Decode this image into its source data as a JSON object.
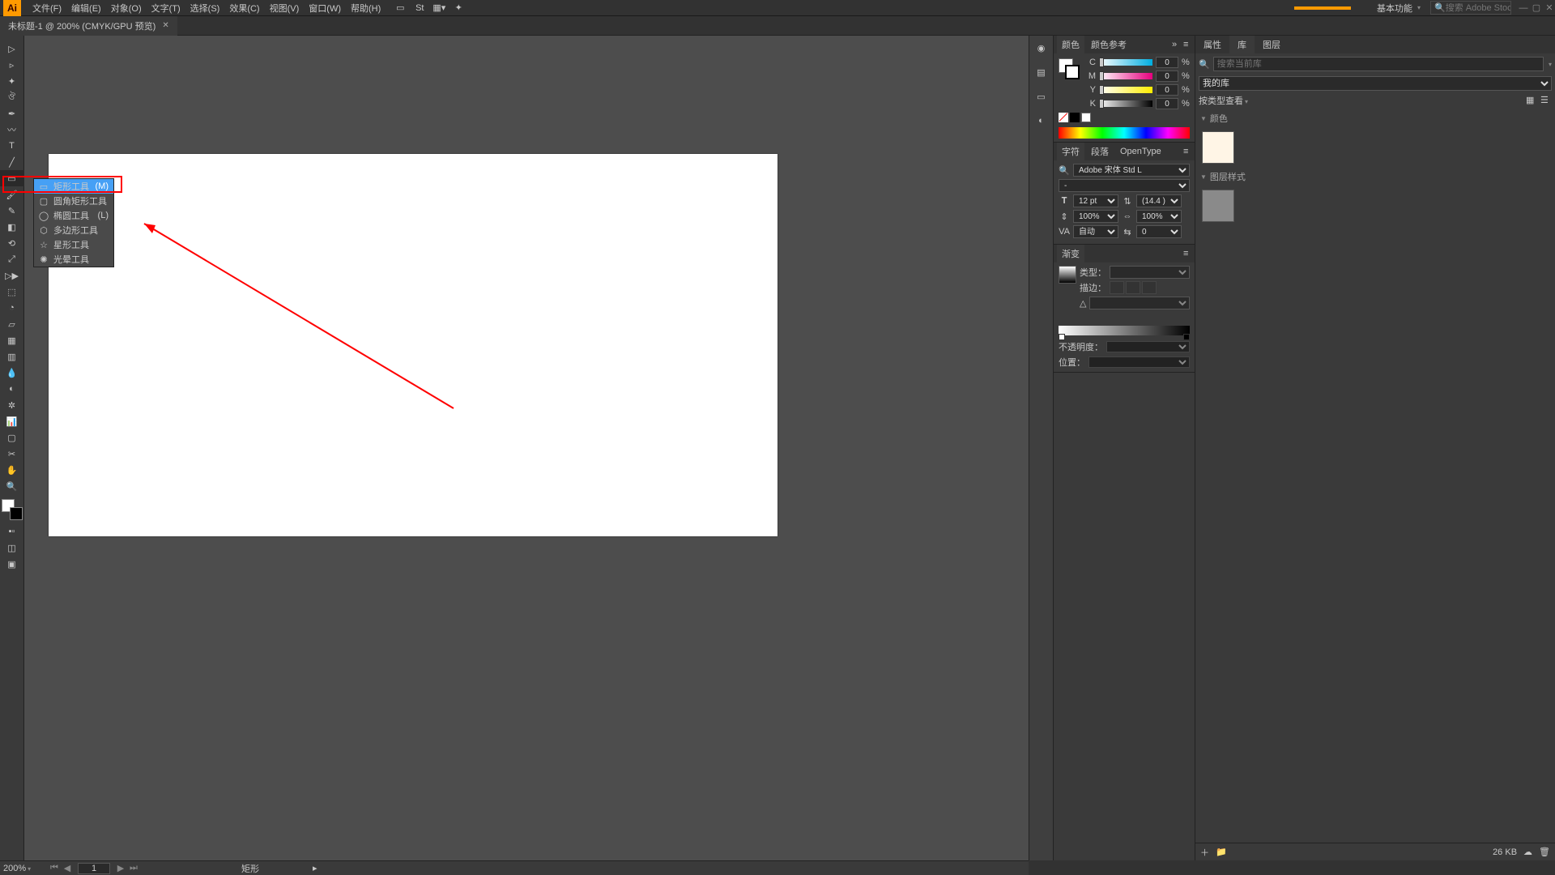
{
  "menu": {
    "items": [
      "文件(F)",
      "编辑(E)",
      "对象(O)",
      "文字(T)",
      "选择(S)",
      "效果(C)",
      "视图(V)",
      "窗口(W)",
      "帮助(H)"
    ],
    "workspace": "基本功能",
    "search_placeholder": "搜索 Adobe Stock"
  },
  "doc": {
    "title": "未标题-1 @ 200% (CMYK/GPU 预览)"
  },
  "flyout": {
    "items": [
      {
        "label": "矩形工具",
        "shortcut": "(M)",
        "active": true
      },
      {
        "label": "圆角矩形工具",
        "shortcut": ""
      },
      {
        "label": "椭圆工具",
        "shortcut": "(L)"
      },
      {
        "label": "多边形工具",
        "shortcut": ""
      },
      {
        "label": "星形工具",
        "shortcut": ""
      },
      {
        "label": "光晕工具",
        "shortcut": ""
      }
    ]
  },
  "color": {
    "tab1": "颜色",
    "tab2": "颜色参考",
    "channels": [
      {
        "l": "C",
        "v": "0"
      },
      {
        "l": "M",
        "v": "0"
      },
      {
        "l": "Y",
        "v": "0"
      },
      {
        "l": "K",
        "v": "0"
      }
    ],
    "pct": "%"
  },
  "char": {
    "tab1": "字符",
    "tab2": "段落",
    "tab3": "OpenType",
    "font": "Adobe 宋体 Std L",
    "style": "-",
    "size": "12 pt",
    "leading": "(14.4 )",
    "hscale": "100%",
    "vscale": "100%",
    "tracking": "自动",
    "baseline": "0"
  },
  "grad": {
    "tab": "渐变",
    "type_label": "类型：",
    "stroke_label": "描边：",
    "angle_label": "△",
    "opacity_label": "不透明度：",
    "location_label": "位置："
  },
  "libs": {
    "tabs": [
      "属性",
      "库",
      "图层"
    ],
    "search_placeholder": "搜索当前库",
    "my_lib": "我的库",
    "sort": "按类型查看",
    "section_color": "颜色",
    "section_style": "图层样式",
    "footer_size": "26 KB"
  },
  "status": {
    "zoom": "200%",
    "artboard": "1",
    "tool": "矩形"
  }
}
